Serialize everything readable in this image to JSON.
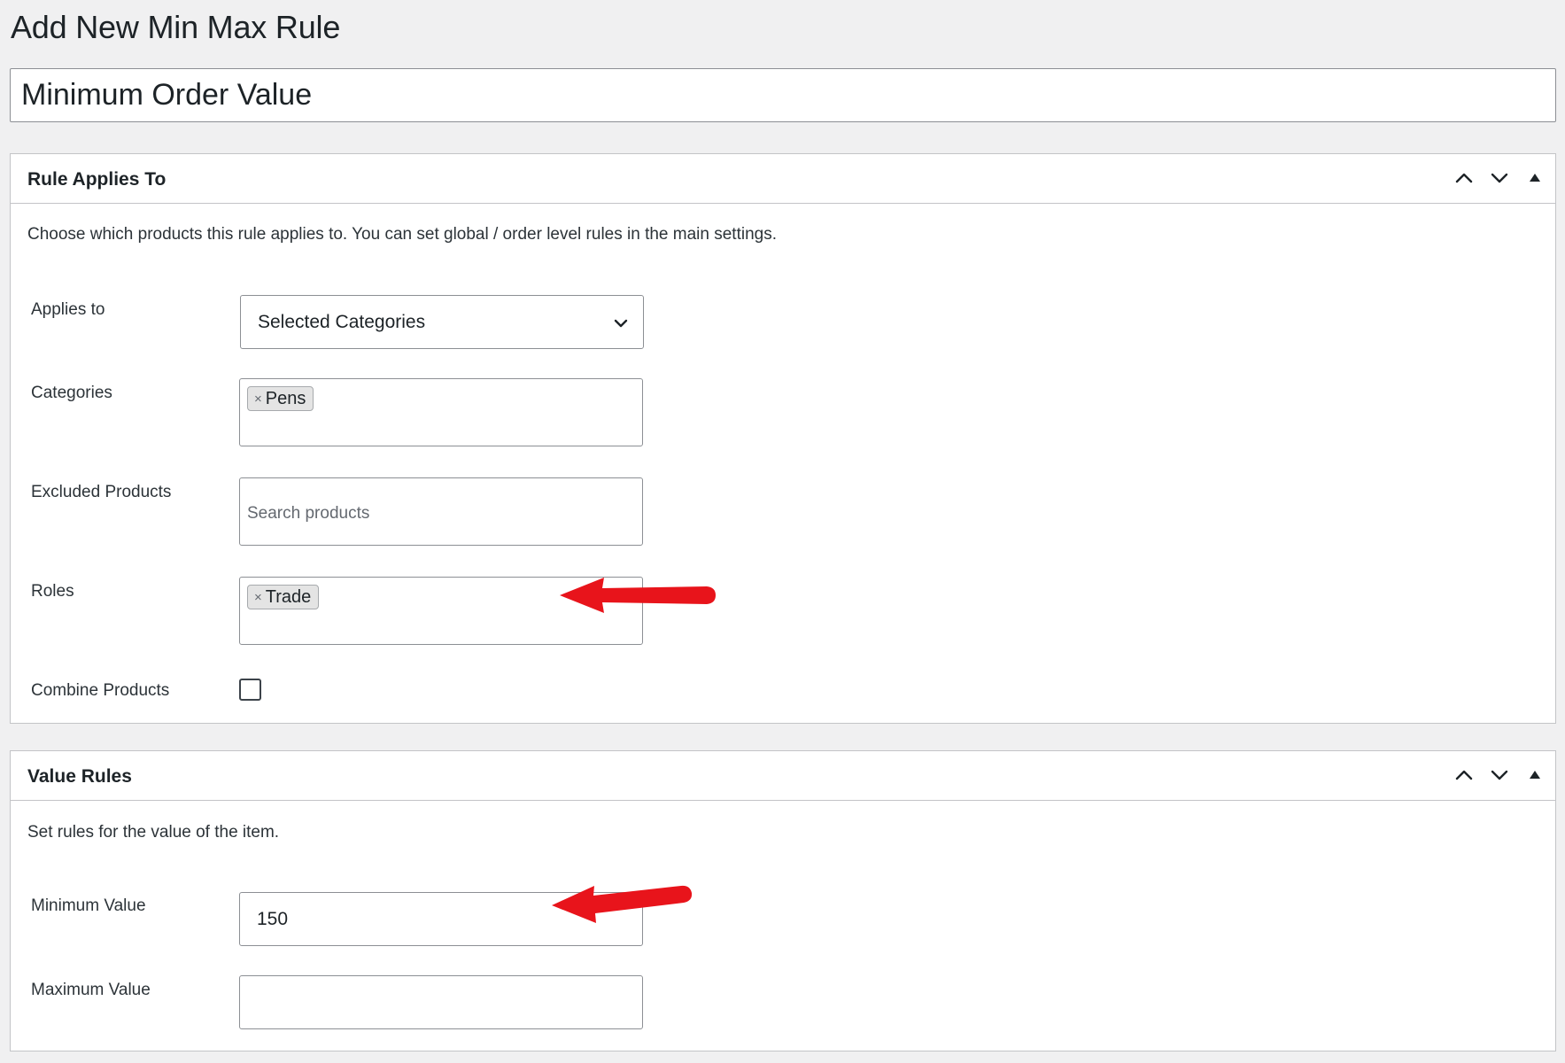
{
  "page": {
    "title": "Add New Min Max Rule",
    "rule_title_value": "Minimum Order Value"
  },
  "rule_applies_to": {
    "title": "Rule Applies To",
    "description": "Choose which products this rule applies to. You can set global / order level rules in the main settings.",
    "applies_to": {
      "label": "Applies to",
      "selected": "Selected Categories"
    },
    "categories": {
      "label": "Categories",
      "tokens": [
        "Pens"
      ]
    },
    "excluded_products": {
      "label": "Excluded Products",
      "placeholder": "Search products"
    },
    "roles": {
      "label": "Roles",
      "tokens": [
        "Trade"
      ]
    },
    "combine_products": {
      "label": "Combine Products",
      "checked": false
    }
  },
  "value_rules": {
    "title": "Value Rules",
    "description": "Set rules for the value of the item.",
    "minimum_value": {
      "label": "Minimum Value",
      "value": "150"
    },
    "maximum_value": {
      "label": "Maximum Value",
      "value": ""
    }
  },
  "icons": {
    "move_up": "chevron-up-icon",
    "move_down": "chevron-down-icon",
    "toggle": "triangle-up-icon",
    "select_caret": "chevron-down-icon",
    "token_remove": "close-icon"
  },
  "colors": {
    "page_background": "#f0f0f1",
    "panel_background": "#ffffff",
    "border": "#c3c4c7",
    "input_border": "#8c8f94",
    "token_background": "#e4e4e4",
    "annotation_arrow": "#e8141b"
  }
}
